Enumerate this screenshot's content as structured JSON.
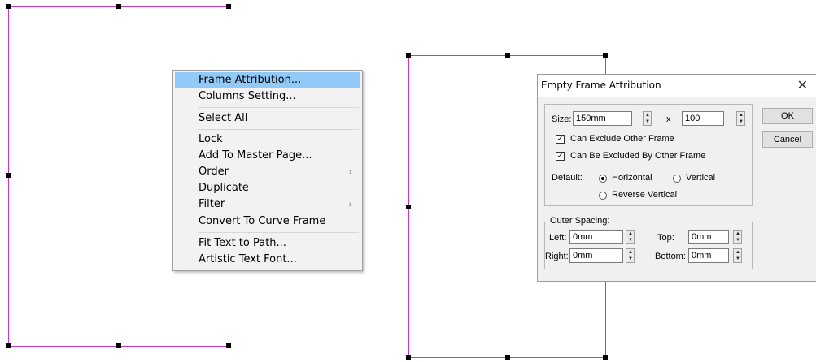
{
  "context_menu": {
    "items": [
      {
        "label": "Frame Attribution...",
        "highlighted": true
      },
      {
        "label": "Columns Setting..."
      },
      {
        "label": "Select All"
      },
      {
        "label": "Lock"
      },
      {
        "label": "Add To Master Page..."
      },
      {
        "label": "Order",
        "submenu_icon": "chevron-right-icon"
      },
      {
        "label": "Duplicate"
      },
      {
        "label": "Filter",
        "submenu_icon": "chevron-right-icon"
      },
      {
        "label": "Convert To Curve Frame"
      },
      {
        "label": "Fit Text to Path..."
      },
      {
        "label": "Artistic Text Font..."
      }
    ],
    "submenu_glyph": "›"
  },
  "dialog": {
    "title": "Empty Frame Attribution",
    "close_glyph": "✕",
    "size_label": "Size:",
    "width_value": "150mm",
    "x_label": "x",
    "height_value": "100",
    "can_exclude_label": "Can Exclude Other Frame",
    "can_exclude_checked": true,
    "can_be_excluded_label": "Can Be Excluded By Other Frame",
    "can_be_excluded_checked": true,
    "default_label": "Default:",
    "options": {
      "horizontal": "Horizontal",
      "vertical": "Vertical",
      "reverse_vertical": "Reverse Vertical"
    },
    "selected_option": "Horizontal",
    "outer_spacing_label": "Outer Spacing:",
    "left_label": "Left:",
    "left_value": "0mm",
    "top_label": "Top:",
    "top_value": "0mm",
    "right_label": "Right:",
    "right_value": "0mm",
    "bottom_label": "Bottom:",
    "bottom_value": "0mm",
    "ok_label": "OK",
    "cancel_label": "Cancel",
    "check_glyph": "✓"
  },
  "colors": {
    "frame_border": "#cc33cc",
    "menu_highlight": "#91c9f7"
  }
}
